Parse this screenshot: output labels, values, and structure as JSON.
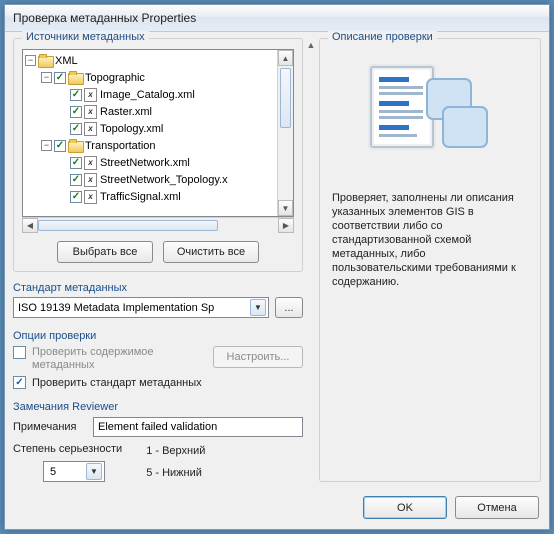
{
  "window": {
    "title": "Проверка метаданных Properties"
  },
  "sources": {
    "title": "Источники метаданных",
    "root": "XML",
    "group1": "Topographic",
    "group1_items": [
      "Image_Catalog.xml",
      "Raster.xml",
      "Topology.xml"
    ],
    "group2": "Transportation",
    "group2_items": [
      "StreetNetwork.xml",
      "StreetNetwork_Topology.x",
      "TrafficSignal.xml"
    ],
    "select_all": "Выбрать все",
    "clear_all": "Очистить все"
  },
  "standard": {
    "title": "Стандарт метаданных",
    "value": "ISO 19139 Metadata Implementation Sp",
    "browse": "..."
  },
  "options": {
    "title": "Опции проверки",
    "opt1": "Проверить  содержимое метаданных",
    "configure": "Настроить...",
    "opt2": "Проверить стандарт метаданных"
  },
  "reviewer": {
    "title": "Замечания Reviewer",
    "notes_label": "Примечания",
    "notes_value": "Element failed validation",
    "severity_label": "Степень серьезности",
    "severity_value": "5",
    "legend_top": "1 - Верхний",
    "legend_bottom": "5 - Нижний"
  },
  "description": {
    "title": "Описание проверки",
    "text": "Проверяет, заполнены ли описания указанных элементов GIS в соответствии либо со стандартизованной схемой метаданных, либо пользовательскими требованиями к содержанию."
  },
  "buttons": {
    "ok": "OK",
    "cancel": "Отмена"
  }
}
